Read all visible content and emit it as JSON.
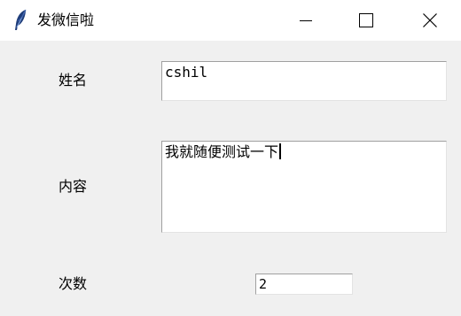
{
  "window": {
    "title": "发微信啦",
    "app_icon": "feather-icon",
    "controls": [
      "minimize-icon",
      "maximize-icon",
      "close-icon"
    ]
  },
  "form": {
    "name_label": "姓名",
    "name_value": "cshil",
    "content_label": "内容",
    "content_value": "我就随便测试一下",
    "count_label": "次数",
    "count_value": "2"
  }
}
